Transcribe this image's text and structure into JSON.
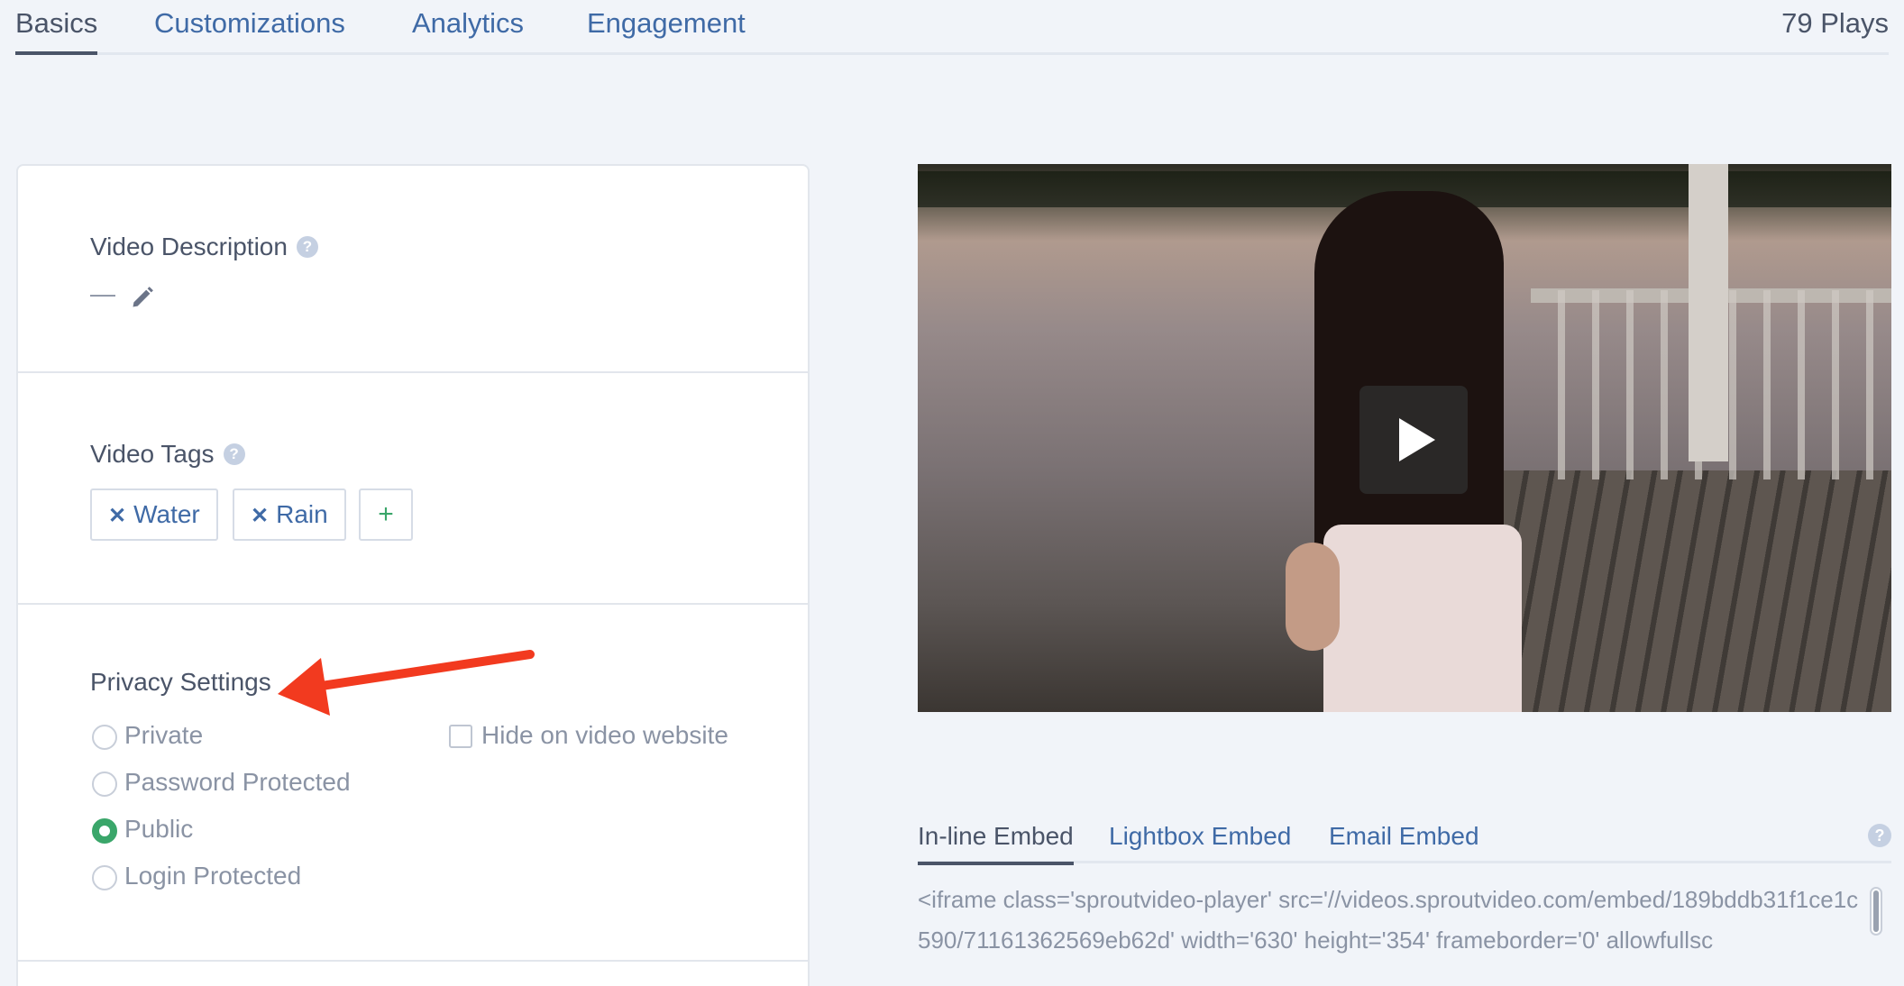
{
  "top_tabs": {
    "items": [
      {
        "label": "Basics"
      },
      {
        "label": "Customizations"
      },
      {
        "label": "Analytics"
      },
      {
        "label": "Engagement"
      }
    ],
    "plays": "79 Plays"
  },
  "description": {
    "title": "Video Description",
    "value": "—"
  },
  "tags": {
    "title": "Video Tags",
    "items": [
      "Water",
      "Rain"
    ],
    "add_label": "+"
  },
  "privacy": {
    "title": "Privacy Settings",
    "options": [
      "Private",
      "Password Protected",
      "Public",
      "Login Protected"
    ],
    "selected": "Public",
    "hide_label": "Hide on video website"
  },
  "embed": {
    "tabs": [
      "In-line Embed",
      "Lightbox Embed",
      "Email Embed"
    ],
    "code": "<iframe class='sproutvideo-player' src='//videos.sproutvideo.com/embed/189bddb31f1ce1c590/71161362569eb62d' width='630' height='354' frameborder='0' allowfullsc"
  },
  "colors": {
    "link": "#3f6aa6",
    "text": "#4a5468",
    "selected_radio": "#3aa66a",
    "annotation_arrow": "#f23a1f"
  }
}
